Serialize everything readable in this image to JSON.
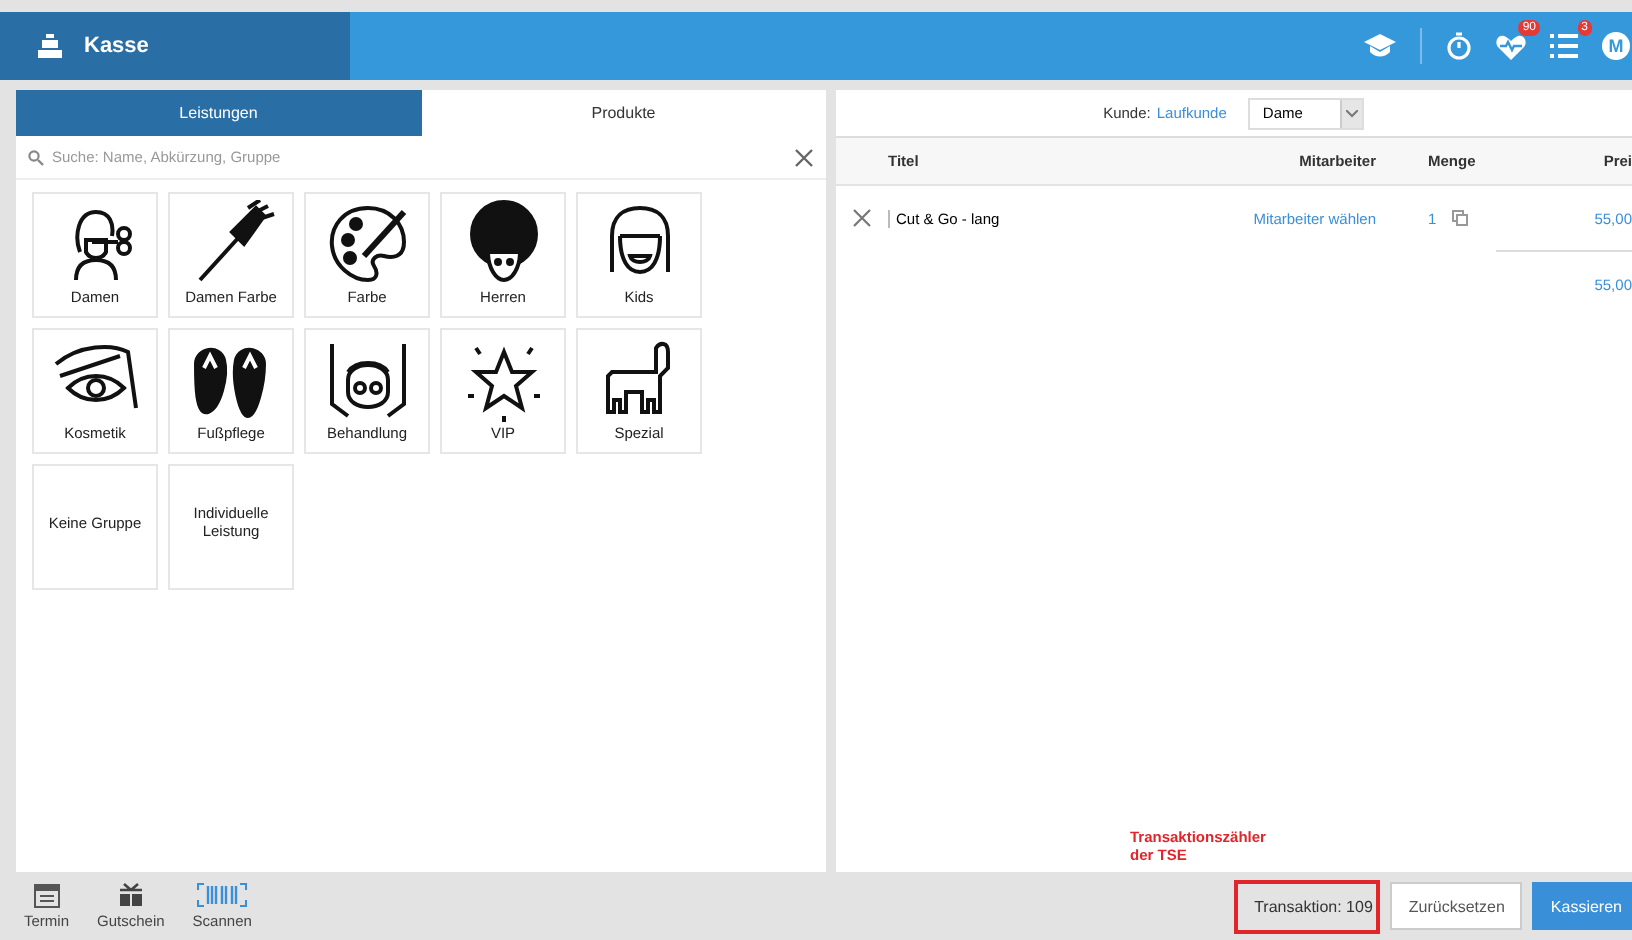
{
  "header": {
    "title": "Kasse",
    "badges": [
      {
        "count": "90"
      },
      {
        "count": "3"
      }
    ],
    "avatar": "M"
  },
  "left": {
    "tabs": [
      {
        "label": "Leistungen",
        "selected": true
      },
      {
        "label": "Produkte",
        "selected": false
      }
    ],
    "search": {
      "placeholder": "Suche: Name, Abkürzung, Gruppe"
    },
    "tiles": [
      {
        "label": "Damen",
        "kind": "icon"
      },
      {
        "label": "Damen Farbe",
        "kind": "icon"
      },
      {
        "label": "Farbe",
        "kind": "icon"
      },
      {
        "label": "Herren",
        "kind": "icon"
      },
      {
        "label": "Kids",
        "kind": "icon"
      },
      {
        "label": "Kosmetik",
        "kind": "icon"
      },
      {
        "label": "Fußpflege",
        "kind": "icon"
      },
      {
        "label": "Behandlung",
        "kind": "icon"
      },
      {
        "label": "VIP",
        "kind": "icon"
      },
      {
        "label": "Spezial",
        "kind": "icon"
      },
      {
        "label": "Keine Gruppe",
        "kind": "plain"
      },
      {
        "label": "Individuelle Leistung",
        "kind": "plain"
      }
    ]
  },
  "right": {
    "customer_label": "Kunde:",
    "customer": "Laufkunde",
    "salutation": "Dame",
    "columns": [
      "Titel",
      "Mitarbeiter",
      "Menge",
      "Prei"
    ],
    "rows": [
      {
        "title": "Cut & Go - lang",
        "employee": "Mitarbeiter wählen",
        "quantity": "1",
        "price": "55,00"
      }
    ],
    "total": "55,00"
  },
  "annotation": "Transaktionszähler der TSE",
  "footer": {
    "tools": [
      {
        "label": "Termin"
      },
      {
        "label": "Gutschein"
      },
      {
        "label": "Scannen",
        "selected": true
      }
    ],
    "transaction": "Transaktion: 109",
    "buttons": [
      {
        "label": "Zurücksetzen",
        "kind": "secondary"
      },
      {
        "label": "Kassieren",
        "kind": "primary"
      }
    ]
  }
}
